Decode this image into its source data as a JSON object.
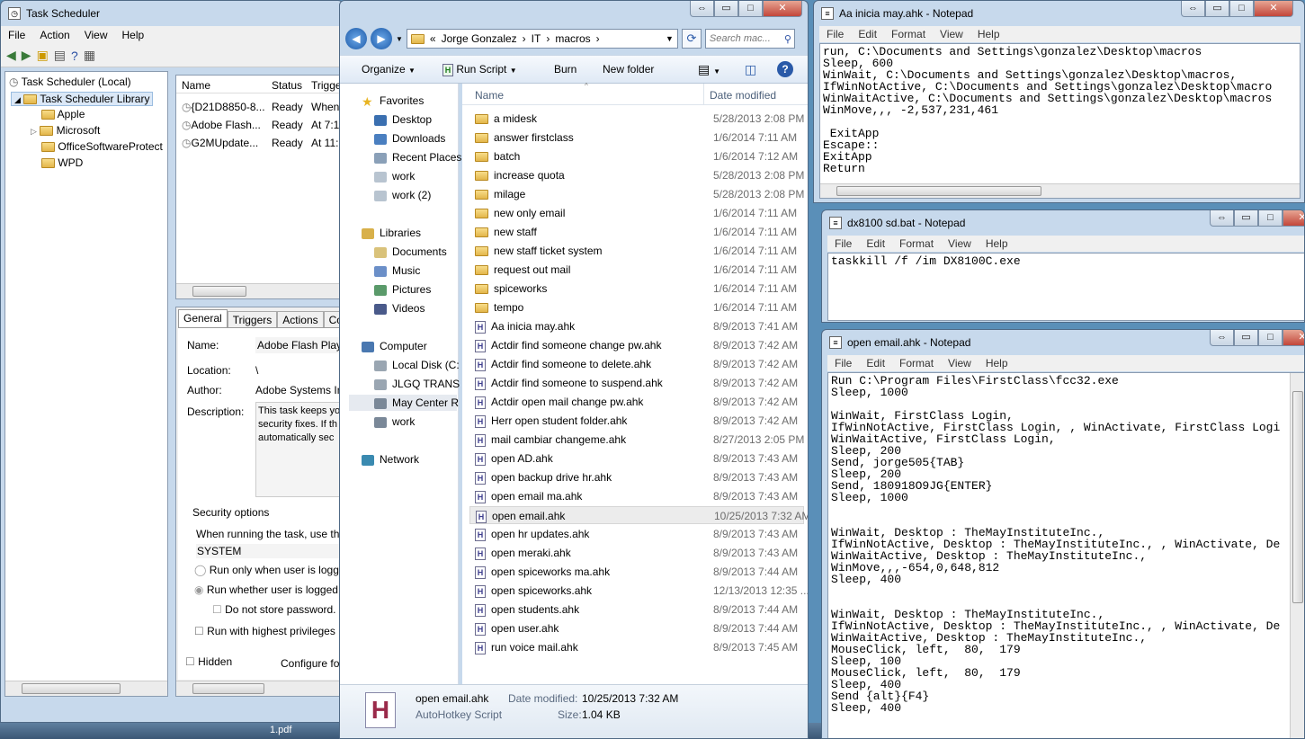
{
  "taskbar": {
    "pdf_label": "1.pdf"
  },
  "task_scheduler": {
    "title": "Task Scheduler",
    "menu": [
      "File",
      "Action",
      "View",
      "Help"
    ],
    "tree": {
      "root": "Task Scheduler (Local)",
      "library": "Task Scheduler Library",
      "children": [
        "Apple",
        "Microsoft",
        "OfficeSoftwareProtect",
        "WPD"
      ]
    },
    "columns": [
      "Name",
      "Status",
      "Trigge"
    ],
    "tasks": [
      {
        "name": "{D21D8850-8...",
        "status": "Ready",
        "trigger": "When"
      },
      {
        "name": "Adobe Flash...",
        "status": "Ready",
        "trigger": "At 7:1"
      },
      {
        "name": "G2MUpdate...",
        "status": "Ready",
        "trigger": "At 11:"
      }
    ],
    "tabs": [
      "General",
      "Triggers",
      "Actions",
      "Co"
    ],
    "labels": {
      "name": "Name:",
      "location": "Location:",
      "author": "Author:",
      "description": "Description:"
    },
    "values": {
      "name": "Adobe Flash Playe",
      "location": "\\",
      "author": "Adobe Systems In",
      "description": "This task keeps yo security fixes. If th automatically sec"
    },
    "security": {
      "header": "Security options",
      "prompt": "When running the task, use the",
      "account": "SYSTEM",
      "opt1": "Run only when user is logg",
      "opt2": "Run whether user is logged",
      "store": "Do not store password.",
      "highest": "Run with highest privileges",
      "hidden": "Hidden",
      "configure": "Configure fo"
    }
  },
  "explorer": {
    "breadcrumb": [
      "«",
      "Jorge Gonzalez",
      "IT",
      "macros"
    ],
    "search_placeholder": "Search mac...",
    "toolbar": {
      "organize": "Organize",
      "run_script": "Run Script",
      "burn": "Burn",
      "new_folder": "New folder"
    },
    "nav": {
      "favorites": "Favorites",
      "fav_items": [
        "Desktop",
        "Downloads",
        "Recent Places",
        "work",
        "work (2)"
      ],
      "libraries": "Libraries",
      "lib_items": [
        "Documents",
        "Music",
        "Pictures",
        "Videos"
      ],
      "computer": "Computer",
      "comp_items": [
        "Local Disk (C:",
        "JLGQ TRANS (",
        "May Center R",
        "work"
      ],
      "network": "Network"
    },
    "columns": {
      "name": "Name",
      "date": "Date modified"
    },
    "files": [
      {
        "name": "a midesk",
        "date": "5/28/2013 2:08 PM",
        "type": "folder"
      },
      {
        "name": "answer firstclass",
        "date": "1/6/2014 7:11 AM",
        "type": "folder"
      },
      {
        "name": "batch",
        "date": "1/6/2014 7:12 AM",
        "type": "folder"
      },
      {
        "name": "increase quota",
        "date": "5/28/2013 2:08 PM",
        "type": "folder"
      },
      {
        "name": "milage",
        "date": "5/28/2013 2:08 PM",
        "type": "folder"
      },
      {
        "name": "new only email",
        "date": "1/6/2014 7:11 AM",
        "type": "folder"
      },
      {
        "name": "new staff",
        "date": "1/6/2014 7:11 AM",
        "type": "folder"
      },
      {
        "name": "new staff ticket system",
        "date": "1/6/2014 7:11 AM",
        "type": "folder"
      },
      {
        "name": "request out mail",
        "date": "1/6/2014 7:11 AM",
        "type": "folder"
      },
      {
        "name": "spiceworks",
        "date": "1/6/2014 7:11 AM",
        "type": "folder"
      },
      {
        "name": "tempo",
        "date": "1/6/2014 7:11 AM",
        "type": "folder"
      },
      {
        "name": "Aa inicia may.ahk",
        "date": "8/9/2013 7:41 AM",
        "type": "ahk"
      },
      {
        "name": "Actdir find someone change pw.ahk",
        "date": "8/9/2013 7:42 AM",
        "type": "ahk"
      },
      {
        "name": "Actdir find someone to delete.ahk",
        "date": "8/9/2013 7:42 AM",
        "type": "ahk"
      },
      {
        "name": "Actdir find someone to suspend.ahk",
        "date": "8/9/2013 7:42 AM",
        "type": "ahk"
      },
      {
        "name": "Actdir open mail change pw.ahk",
        "date": "8/9/2013 7:42 AM",
        "type": "ahk"
      },
      {
        "name": "Herr open student folder.ahk",
        "date": "8/9/2013 7:42 AM",
        "type": "ahk"
      },
      {
        "name": "mail cambiar changeme.ahk",
        "date": "8/27/2013 2:05 PM",
        "type": "ahk"
      },
      {
        "name": "open AD.ahk",
        "date": "8/9/2013 7:43 AM",
        "type": "ahk"
      },
      {
        "name": "open backup drive hr.ahk",
        "date": "8/9/2013 7:43 AM",
        "type": "ahk"
      },
      {
        "name": "open email ma.ahk",
        "date": "8/9/2013 7:43 AM",
        "type": "ahk"
      },
      {
        "name": "open email.ahk",
        "date": "10/25/2013 7:32 AM",
        "type": "ahk",
        "selected": true
      },
      {
        "name": "open hr updates.ahk",
        "date": "8/9/2013 7:43 AM",
        "type": "ahk"
      },
      {
        "name": "open meraki.ahk",
        "date": "8/9/2013 7:43 AM",
        "type": "ahk"
      },
      {
        "name": "open spiceworks ma.ahk",
        "date": "8/9/2013 7:44 AM",
        "type": "ahk"
      },
      {
        "name": "open spiceworks.ahk",
        "date": "12/13/2013 12:35 ...",
        "type": "ahk"
      },
      {
        "name": "open students.ahk",
        "date": "8/9/2013 7:44 AM",
        "type": "ahk"
      },
      {
        "name": "open user.ahk",
        "date": "8/9/2013 7:44 AM",
        "type": "ahk"
      },
      {
        "name": "run voice mail.ahk",
        "date": "8/9/2013 7:45 AM",
        "type": "ahk"
      }
    ],
    "details": {
      "name": "open email.ahk",
      "type": "AutoHotkey Script",
      "date_label": "Date modified:",
      "date": "10/25/2013 7:32 AM",
      "size_label": "Size:",
      "size": "1.04 KB"
    }
  },
  "notepad1": {
    "title": "Aa inicia may.ahk - Notepad",
    "menu": [
      "File",
      "Edit",
      "Format",
      "View",
      "Help"
    ],
    "text": "run, C:\\Documents and Settings\\gonzalez\\Desktop\\macros\nSleep, 600\nWinWait, C:\\Documents and Settings\\gonzalez\\Desktop\\macros,\nIfWinNotActive, C:\\Documents and Settings\\gonzalez\\Desktop\\macro\nWinWaitActive, C:\\Documents and Settings\\gonzalez\\Desktop\\macros\nWinMove,,, -2,537,231,461\n\n ExitApp\nEscape::\nExitApp\nReturn"
  },
  "notepad2": {
    "title": "dx8100 sd.bat - Notepad",
    "menu": [
      "File",
      "Edit",
      "Format",
      "View",
      "Help"
    ],
    "text": "taskkill /f /im DX8100C.exe"
  },
  "notepad3": {
    "title": "open email.ahk - Notepad",
    "menu": [
      "File",
      "Edit",
      "Format",
      "View",
      "Help"
    ],
    "text": "Run C:\\Program Files\\FirstClass\\fcc32.exe\nSleep, 1000\n\nWinWait, FirstClass Login,\nIfWinNotActive, FirstClass Login, , WinActivate, FirstClass Logi\nWinWaitActive, FirstClass Login,\nSleep, 200\nSend, jorge505{TAB}\nSleep, 200\nSend, 180918O9JG{ENTER}\nSleep, 1000\n\n\nWinWait, Desktop : TheMayInstituteInc.,\nIfWinNotActive, Desktop : TheMayInstituteInc., , WinActivate, De\nWinWaitActive, Desktop : TheMayInstituteInc.,\nWinMove,,,-654,0,648,812\nSleep, 400\n\n\nWinWait, Desktop : TheMayInstituteInc.,\nIfWinNotActive, Desktop : TheMayInstituteInc., , WinActivate, De\nWinWaitActive, Desktop : TheMayInstituteInc.,\nMouseClick, left,  80,  179\nSleep, 100\nMouseClick, left,  80,  179\nSleep, 400\nSend {alt}{F4}\nSleep, 400"
  }
}
